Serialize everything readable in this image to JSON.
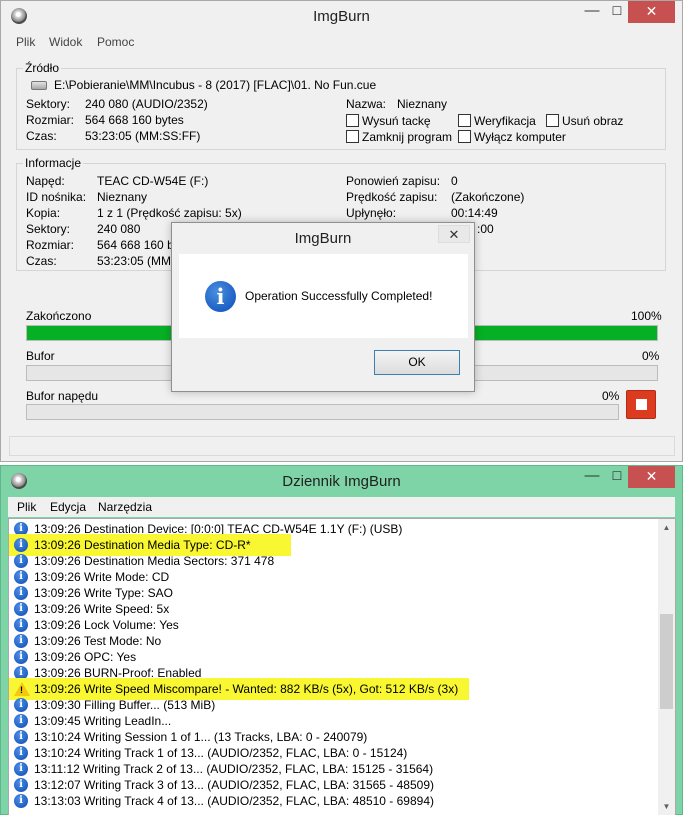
{
  "main_window": {
    "title": "ImgBurn",
    "menu": [
      "Plik",
      "Widok",
      "Pomoc"
    ],
    "source": {
      "legend": "Źródło",
      "file": "E:\\Pobieranie\\MM\\Incubus - 8 (2017) [FLAC]\\01. No Fun.cue",
      "rows": [
        {
          "label": "Sektory:",
          "value": "240 080 (AUDIO/2352)"
        },
        {
          "label": "Rozmiar:",
          "value": "564 668 160 bytes"
        },
        {
          "label": "Czas:",
          "value": "53:23:05 (MM:SS:FF)"
        }
      ],
      "name_label": "Nazwa:",
      "name_value": "Nieznany",
      "checkboxes": [
        "Wysuń tackę",
        "Weryfikacja",
        "Usuń obraz",
        "Zamknij program",
        "Wyłącz komputer"
      ]
    },
    "info": {
      "legend": "Informacje",
      "left": [
        {
          "label": "Napęd:",
          "value": "TEAC CD-W54E (F:)"
        },
        {
          "label": "ID nośnika:",
          "value": "Nieznany"
        },
        {
          "label": "Kopia:",
          "value": "1 z 1 (Prędkość zapisu: 5x)"
        },
        {
          "label": "Sektory:",
          "value": "240 080"
        },
        {
          "label": "Rozmiar:",
          "value": "564 668 160 b"
        },
        {
          "label": "Czas:",
          "value": "53:23:05 (MM:"
        }
      ],
      "right": [
        {
          "label": "Ponowień zapisu:",
          "value": "0"
        },
        {
          "label": "Prędkość zapisu:",
          "value": "(Zakończone)"
        },
        {
          "label": "Upłynęło:",
          "value": "00:14:49"
        },
        {
          "label": "",
          "value": ":00"
        }
      ]
    },
    "progress": {
      "label": "Zakończono",
      "percent_label": "100%",
      "fraction": 1.0,
      "buffer_label": "Bufor",
      "buffer_percent": "0%",
      "buffer_fraction": 0.0,
      "drive_buffer_label": "Bufor napędu",
      "drive_buffer_percent": "0%",
      "drive_buffer_fraction": 0.0
    }
  },
  "dialog": {
    "title": "ImgBurn",
    "close": "✕",
    "message": "Operation Successfully Completed!",
    "ok_label": "OK",
    "icon": "info-icon"
  },
  "log_window": {
    "title": "Dziennik ImgBurn",
    "menu": [
      "Plik",
      "Edycja",
      "Narzędzia"
    ],
    "highlight_color": "#f9f731",
    "lines": [
      {
        "type": "info",
        "text": "13:09:26 Destination Device: [0:0:0] TEAC CD-W54E 1.1Y (F:) (USB)",
        "highlight": false
      },
      {
        "type": "info",
        "text": "13:09:26 Destination Media Type: CD-R*",
        "highlight": true
      },
      {
        "type": "info",
        "text": "13:09:26 Destination Media Sectors: 371 478",
        "highlight": false
      },
      {
        "type": "info",
        "text": "13:09:26 Write Mode: CD",
        "highlight": false
      },
      {
        "type": "info",
        "text": "13:09:26 Write Type: SAO",
        "highlight": false
      },
      {
        "type": "info",
        "text": "13:09:26 Write Speed: 5x",
        "highlight": false
      },
      {
        "type": "info",
        "text": "13:09:26 Lock Volume: Yes",
        "highlight": false
      },
      {
        "type": "info",
        "text": "13:09:26 Test Mode: No",
        "highlight": false
      },
      {
        "type": "info",
        "text": "13:09:26 OPC: Yes",
        "highlight": false
      },
      {
        "type": "info",
        "text": "13:09:26 BURN-Proof: Enabled",
        "highlight": false
      },
      {
        "type": "warning",
        "text": "13:09:26 Write Speed Miscompare! - Wanted: 882 KB/s (5x), Got: 512 KB/s (3x)",
        "highlight": true
      },
      {
        "type": "info",
        "text": "13:09:30 Filling Buffer... (513 MiB)",
        "highlight": false
      },
      {
        "type": "info",
        "text": "13:09:45 Writing LeadIn...",
        "highlight": false
      },
      {
        "type": "info",
        "text": "13:10:24 Writing Session 1 of 1... (13 Tracks, LBA: 0 - 240079)",
        "highlight": false
      },
      {
        "type": "info",
        "text": "13:10:24 Writing Track 1 of 13... (AUDIO/2352, FLAC, LBA: 0 - 15124)",
        "highlight": false
      },
      {
        "type": "info",
        "text": "13:11:12 Writing Track 2 of 13... (AUDIO/2352, FLAC, LBA: 15125 - 31564)",
        "highlight": false
      },
      {
        "type": "info",
        "text": "13:12:07 Writing Track 3 of 13... (AUDIO/2352, FLAC, LBA: 31565 - 48509)",
        "highlight": false
      },
      {
        "type": "info",
        "text": "13:13:03 Writing Track 4 of 13... (AUDIO/2352, FLAC, LBA: 48510 - 69894)",
        "highlight": false
      }
    ]
  }
}
